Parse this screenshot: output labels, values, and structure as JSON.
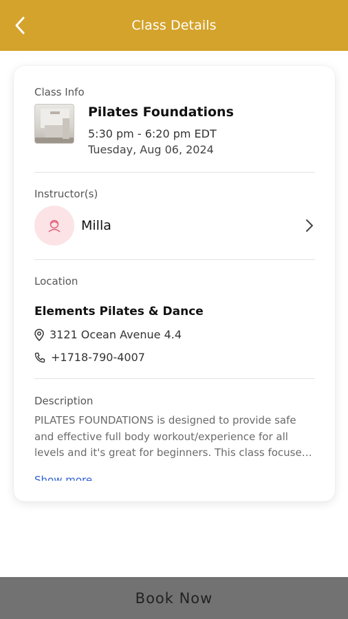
{
  "header": {
    "title": "Class Details",
    "back_icon": "chevron-left-icon",
    "color": "#d4a32c"
  },
  "class_info": {
    "label": "Class Info",
    "title": "Pilates Foundations",
    "time": "5:30 pm - 6:20 pm EDT",
    "date": "Tuesday, Aug 06, 2024"
  },
  "instructors": {
    "label": "Instructor(s)",
    "items": [
      {
        "name": "Milla",
        "avatar_icon": "person-icon"
      }
    ]
  },
  "location": {
    "label": "Location",
    "name": "Elements Pilates & Dance",
    "address": "3121 Ocean Avenue 4.4",
    "phone": "+1718-790-4007"
  },
  "description": {
    "label": "Description",
    "text": "PILATES FOUNDATIONS is designed to provide safe and effective full body workout/experience for all levels and it's great for beginners. This class focuses on building core strength and proper alignment.",
    "show_more": "Show more"
  },
  "footer": {
    "book_label": "Book Now",
    "color": "#727272"
  }
}
